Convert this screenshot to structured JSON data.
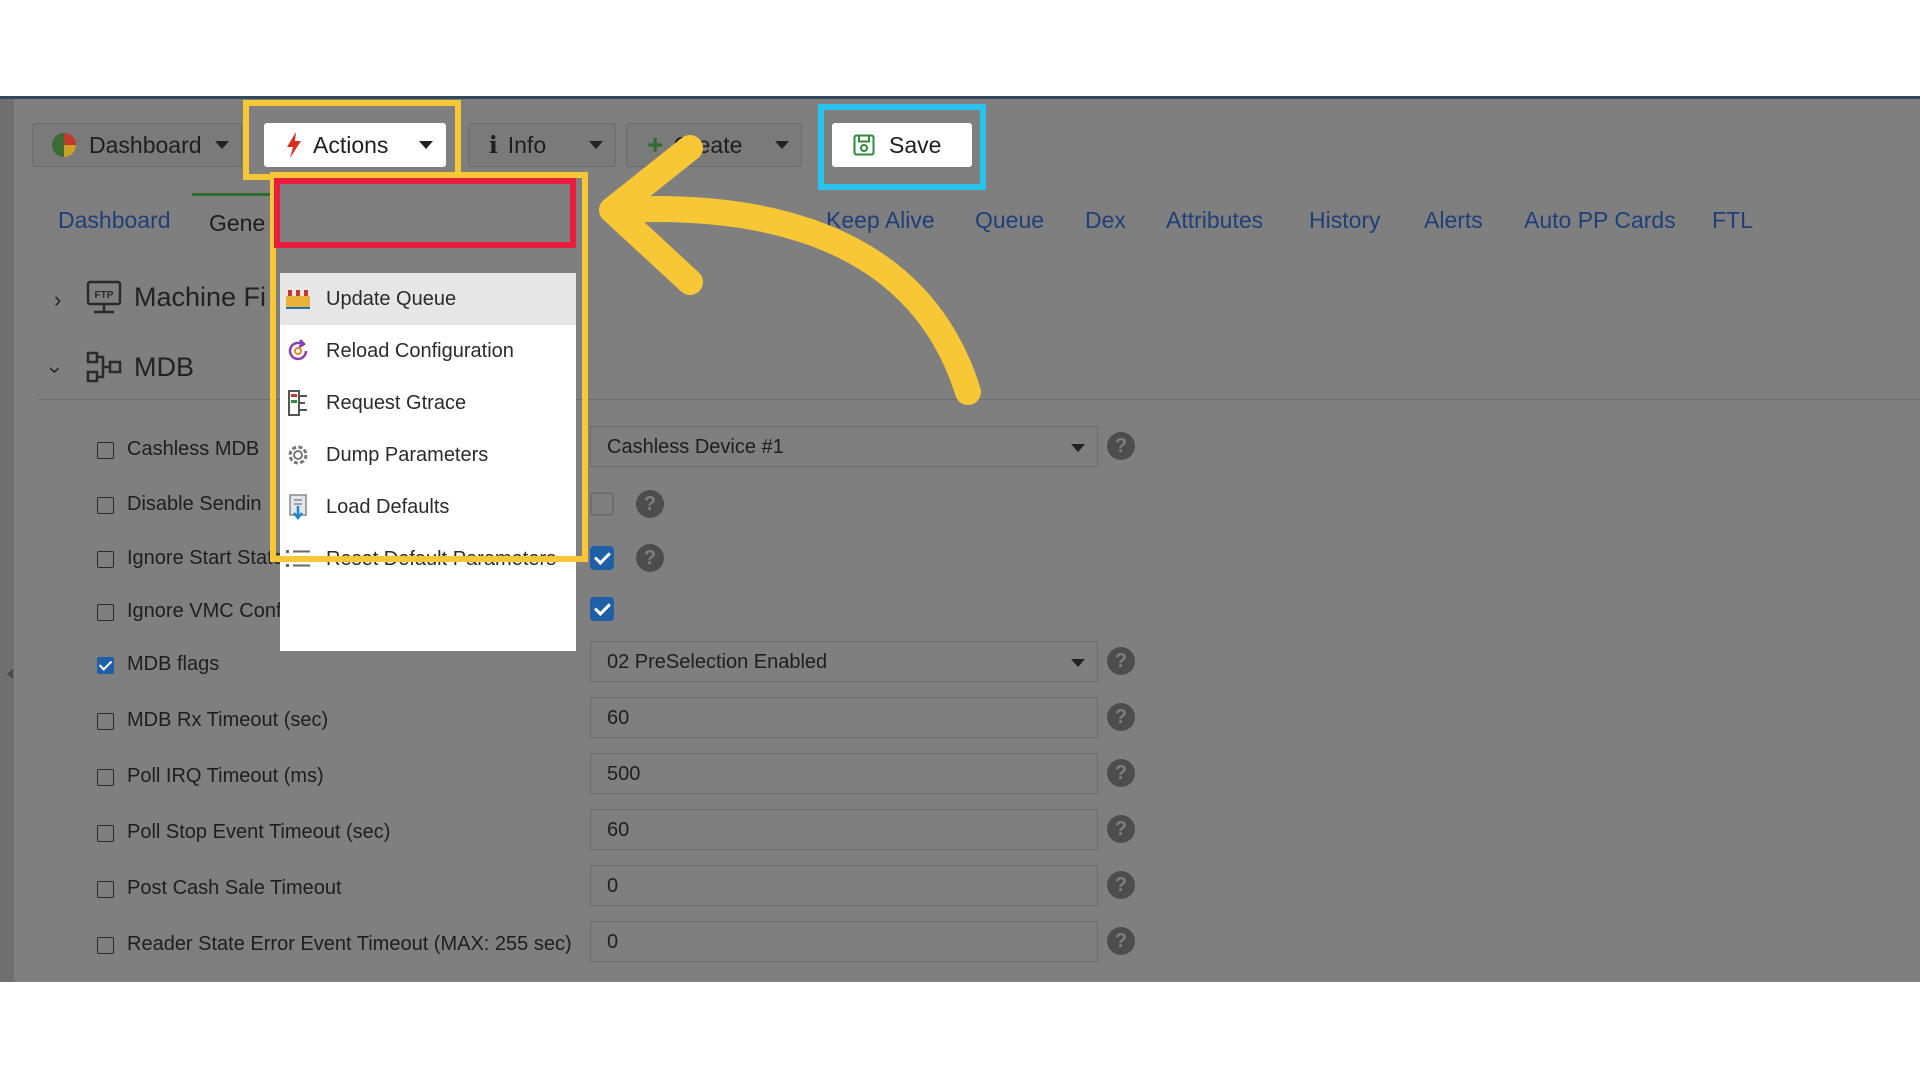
{
  "toolbar": {
    "dashboard_label": "Dashboard",
    "actions_label": "Actions",
    "info_label": "Info",
    "create_label": "Create",
    "save_label": "Save"
  },
  "actions_menu": {
    "items": [
      {
        "label": "Update Queue",
        "icon": "queue-icon"
      },
      {
        "label": "Reload Configuration",
        "icon": "reload-icon"
      },
      {
        "label": "Request Gtrace",
        "icon": "gtrace-icon"
      },
      {
        "label": "Dump Parameters",
        "icon": "gear-icon"
      },
      {
        "label": "Load Defaults",
        "icon": "load-defaults-icon"
      },
      {
        "label": "Reset Default Parameters",
        "icon": "list-icon"
      }
    ]
  },
  "tabs": {
    "items": [
      "Dashboard",
      "Keep Alive",
      "Queue",
      "Dex",
      "Attributes",
      "History",
      "Alerts",
      "Auto PP Cards",
      "FTL"
    ],
    "active_label": "Gene"
  },
  "sections": {
    "machine": "Machine Fi",
    "mdb": "MDB"
  },
  "rows": {
    "cashless_mdb": {
      "label": "Cashless MDB",
      "value": "Cashless Device #1",
      "checked": false
    },
    "disable_sending": {
      "label": "Disable Sendin",
      "value_checked": false,
      "checked": false
    },
    "ignore_start_state": {
      "label": "Ignore Start State",
      "value_checked": true,
      "checked": false
    },
    "ignore_vmc": {
      "label": "Ignore VMC Configuration",
      "value_checked": true,
      "checked": false
    },
    "mdb_flags": {
      "label": "MDB flags",
      "value": "02 PreSelection Enabled",
      "checked": true
    },
    "mdb_rx_timeout": {
      "label": "MDB Rx Timeout (sec)",
      "value": "60",
      "checked": false
    },
    "poll_irq_timeout": {
      "label": "Poll IRQ Timeout (ms)",
      "value": "500",
      "checked": false
    },
    "poll_stop_timeout": {
      "label": "Poll Stop Event Timeout (sec)",
      "value": "60",
      "checked": false
    },
    "post_cash_sale": {
      "label": "Post Cash Sale Timeout",
      "value": "0",
      "checked": false
    },
    "reader_state_error": {
      "label": "Reader State Error Event Timeout (MAX: 255 sec)",
      "value": "0",
      "checked": false
    }
  },
  "colors": {
    "highlight_yellow": "#f7c736",
    "highlight_cyan": "#29c3ef",
    "highlight_red": "#e91e3f",
    "tab_link": "#1f3f78"
  }
}
